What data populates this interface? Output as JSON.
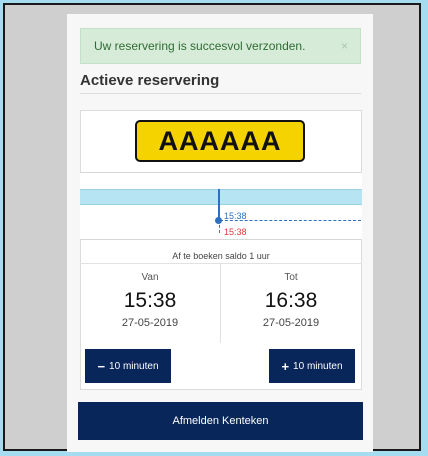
{
  "alert": {
    "message": "Uw reservering is succesvol verzonden.",
    "close": "×"
  },
  "section": {
    "title": "Actieve reservering"
  },
  "plate": {
    "text": "AAAAAA"
  },
  "timeline": {
    "start_label": "15:38",
    "now_label": "15:38"
  },
  "saldo": "Af te boeken saldo 1 uur",
  "van": {
    "label": "Van",
    "time": "15:38",
    "date": "27-05-2019"
  },
  "tot": {
    "label": "Tot",
    "time": "16:38",
    "date": "27-05-2019"
  },
  "buttons": {
    "minus": {
      "icon": "−",
      "label": "10 minuten"
    },
    "plus": {
      "icon": "+",
      "label": "10 minuten"
    },
    "afmelden": "Afmelden Kenteken"
  },
  "colors": {
    "accent": "#08265a",
    "plate": "#f5d300",
    "now": "#e2363a",
    "start": "#2f6fc0"
  }
}
